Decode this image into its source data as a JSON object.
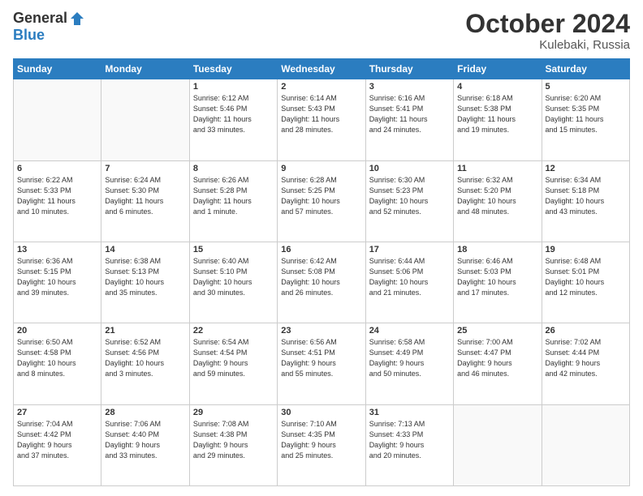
{
  "logo": {
    "general": "General",
    "blue": "Blue"
  },
  "header": {
    "month": "October 2024",
    "location": "Kulebaki, Russia"
  },
  "days_of_week": [
    "Sunday",
    "Monday",
    "Tuesday",
    "Wednesday",
    "Thursday",
    "Friday",
    "Saturday"
  ],
  "weeks": [
    [
      {
        "day": "",
        "info": ""
      },
      {
        "day": "",
        "info": ""
      },
      {
        "day": "1",
        "info": "Sunrise: 6:12 AM\nSunset: 5:46 PM\nDaylight: 11 hours\nand 33 minutes."
      },
      {
        "day": "2",
        "info": "Sunrise: 6:14 AM\nSunset: 5:43 PM\nDaylight: 11 hours\nand 28 minutes."
      },
      {
        "day": "3",
        "info": "Sunrise: 6:16 AM\nSunset: 5:41 PM\nDaylight: 11 hours\nand 24 minutes."
      },
      {
        "day": "4",
        "info": "Sunrise: 6:18 AM\nSunset: 5:38 PM\nDaylight: 11 hours\nand 19 minutes."
      },
      {
        "day": "5",
        "info": "Sunrise: 6:20 AM\nSunset: 5:35 PM\nDaylight: 11 hours\nand 15 minutes."
      }
    ],
    [
      {
        "day": "6",
        "info": "Sunrise: 6:22 AM\nSunset: 5:33 PM\nDaylight: 11 hours\nand 10 minutes."
      },
      {
        "day": "7",
        "info": "Sunrise: 6:24 AM\nSunset: 5:30 PM\nDaylight: 11 hours\nand 6 minutes."
      },
      {
        "day": "8",
        "info": "Sunrise: 6:26 AM\nSunset: 5:28 PM\nDaylight: 11 hours\nand 1 minute."
      },
      {
        "day": "9",
        "info": "Sunrise: 6:28 AM\nSunset: 5:25 PM\nDaylight: 10 hours\nand 57 minutes."
      },
      {
        "day": "10",
        "info": "Sunrise: 6:30 AM\nSunset: 5:23 PM\nDaylight: 10 hours\nand 52 minutes."
      },
      {
        "day": "11",
        "info": "Sunrise: 6:32 AM\nSunset: 5:20 PM\nDaylight: 10 hours\nand 48 minutes."
      },
      {
        "day": "12",
        "info": "Sunrise: 6:34 AM\nSunset: 5:18 PM\nDaylight: 10 hours\nand 43 minutes."
      }
    ],
    [
      {
        "day": "13",
        "info": "Sunrise: 6:36 AM\nSunset: 5:15 PM\nDaylight: 10 hours\nand 39 minutes."
      },
      {
        "day": "14",
        "info": "Sunrise: 6:38 AM\nSunset: 5:13 PM\nDaylight: 10 hours\nand 35 minutes."
      },
      {
        "day": "15",
        "info": "Sunrise: 6:40 AM\nSunset: 5:10 PM\nDaylight: 10 hours\nand 30 minutes."
      },
      {
        "day": "16",
        "info": "Sunrise: 6:42 AM\nSunset: 5:08 PM\nDaylight: 10 hours\nand 26 minutes."
      },
      {
        "day": "17",
        "info": "Sunrise: 6:44 AM\nSunset: 5:06 PM\nDaylight: 10 hours\nand 21 minutes."
      },
      {
        "day": "18",
        "info": "Sunrise: 6:46 AM\nSunset: 5:03 PM\nDaylight: 10 hours\nand 17 minutes."
      },
      {
        "day": "19",
        "info": "Sunrise: 6:48 AM\nSunset: 5:01 PM\nDaylight: 10 hours\nand 12 minutes."
      }
    ],
    [
      {
        "day": "20",
        "info": "Sunrise: 6:50 AM\nSunset: 4:58 PM\nDaylight: 10 hours\nand 8 minutes."
      },
      {
        "day": "21",
        "info": "Sunrise: 6:52 AM\nSunset: 4:56 PM\nDaylight: 10 hours\nand 3 minutes."
      },
      {
        "day": "22",
        "info": "Sunrise: 6:54 AM\nSunset: 4:54 PM\nDaylight: 9 hours\nand 59 minutes."
      },
      {
        "day": "23",
        "info": "Sunrise: 6:56 AM\nSunset: 4:51 PM\nDaylight: 9 hours\nand 55 minutes."
      },
      {
        "day": "24",
        "info": "Sunrise: 6:58 AM\nSunset: 4:49 PM\nDaylight: 9 hours\nand 50 minutes."
      },
      {
        "day": "25",
        "info": "Sunrise: 7:00 AM\nSunset: 4:47 PM\nDaylight: 9 hours\nand 46 minutes."
      },
      {
        "day": "26",
        "info": "Sunrise: 7:02 AM\nSunset: 4:44 PM\nDaylight: 9 hours\nand 42 minutes."
      }
    ],
    [
      {
        "day": "27",
        "info": "Sunrise: 7:04 AM\nSunset: 4:42 PM\nDaylight: 9 hours\nand 37 minutes."
      },
      {
        "day": "28",
        "info": "Sunrise: 7:06 AM\nSunset: 4:40 PM\nDaylight: 9 hours\nand 33 minutes."
      },
      {
        "day": "29",
        "info": "Sunrise: 7:08 AM\nSunset: 4:38 PM\nDaylight: 9 hours\nand 29 minutes."
      },
      {
        "day": "30",
        "info": "Sunrise: 7:10 AM\nSunset: 4:35 PM\nDaylight: 9 hours\nand 25 minutes."
      },
      {
        "day": "31",
        "info": "Sunrise: 7:13 AM\nSunset: 4:33 PM\nDaylight: 9 hours\nand 20 minutes."
      },
      {
        "day": "",
        "info": ""
      },
      {
        "day": "",
        "info": ""
      }
    ]
  ]
}
